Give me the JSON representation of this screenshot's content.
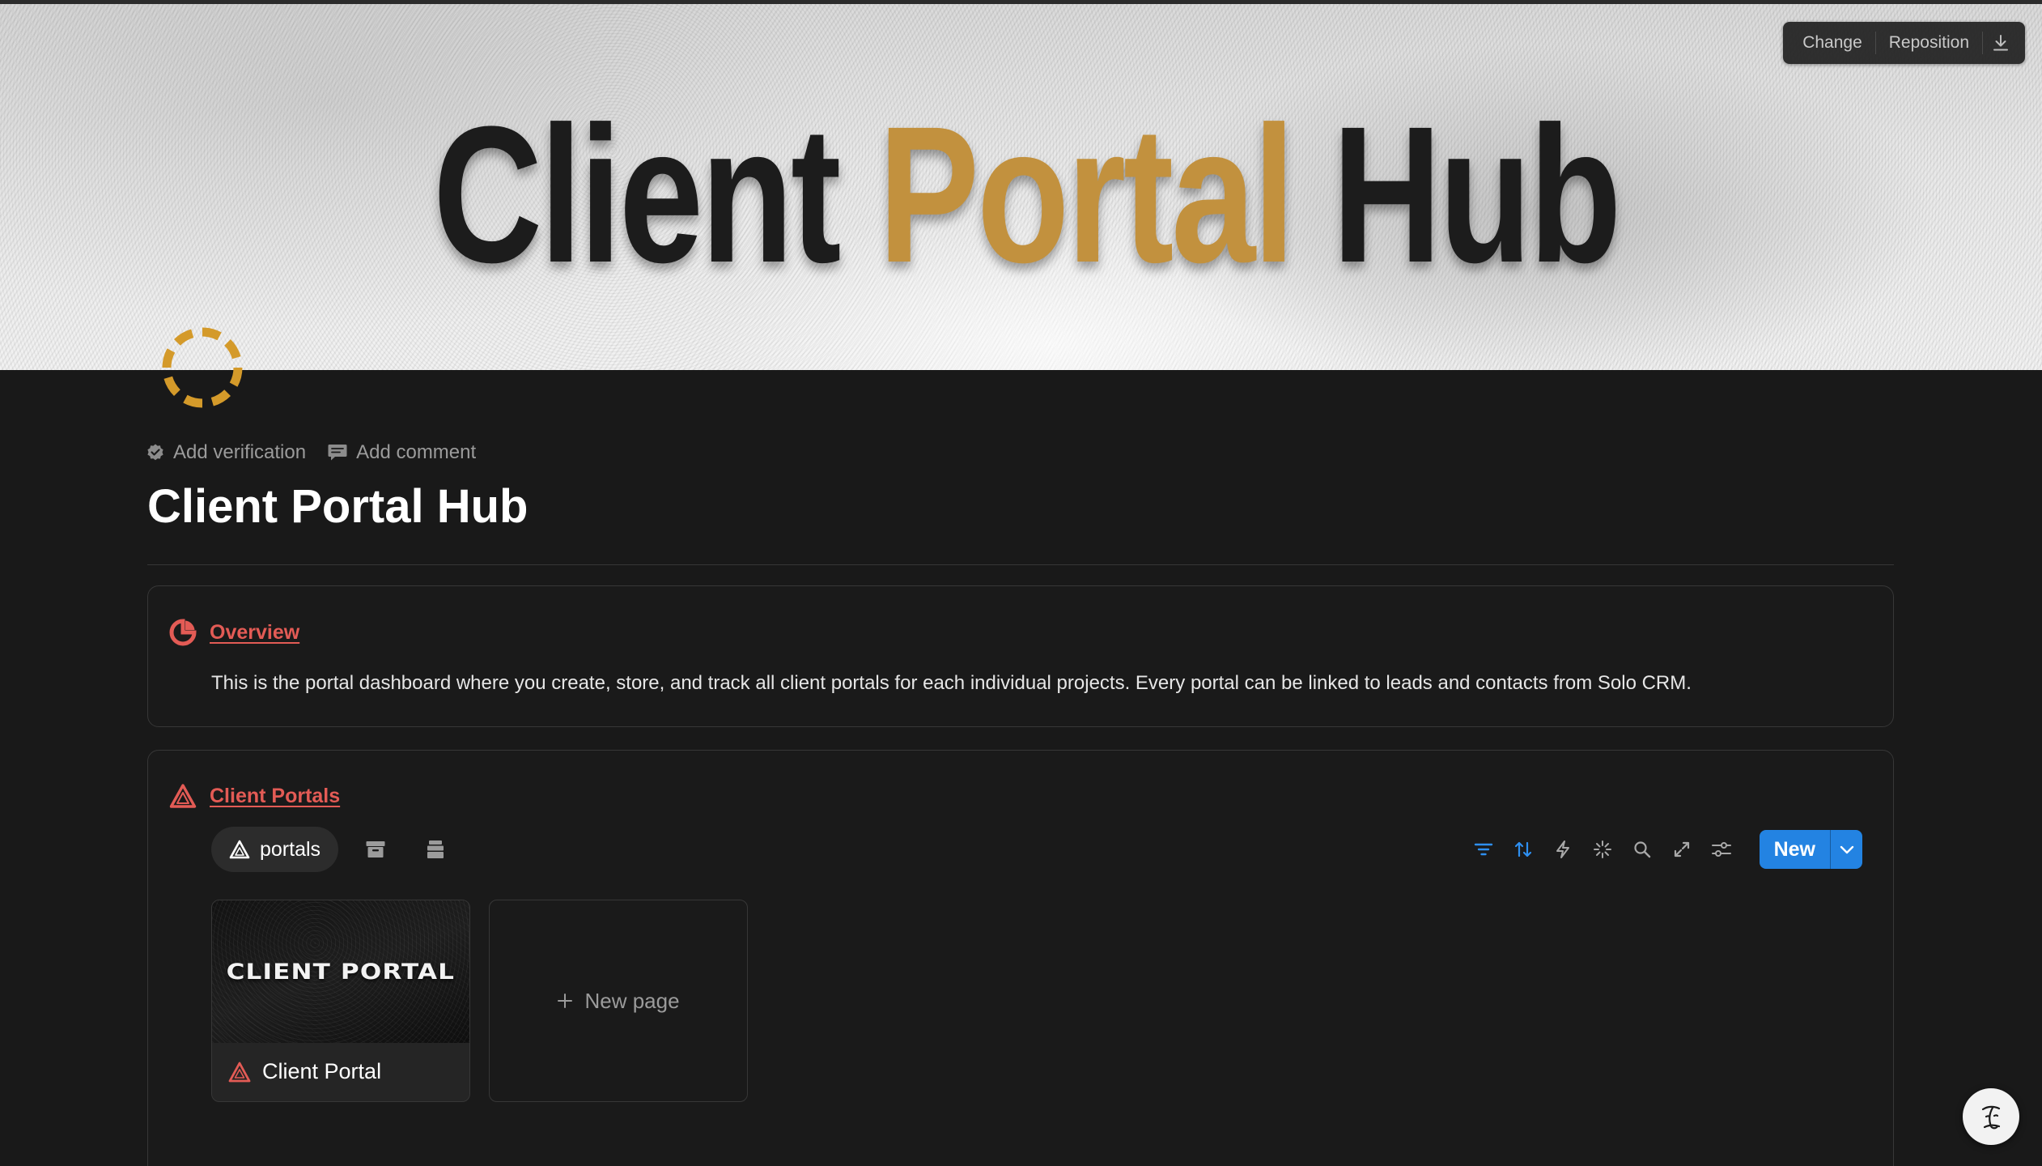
{
  "cover": {
    "title_word1": "Client",
    "title_word2": "Portal",
    "title_word3": "Hub",
    "accent_color": "#c2913e",
    "toolbar": {
      "change_label": "Change",
      "reposition_label": "Reposition",
      "download_icon": "download-icon"
    }
  },
  "page": {
    "icon": "dashed-circle-icon",
    "icon_color": "#d49a2a",
    "add_verification_label": "Add verification",
    "add_comment_label": "Add comment",
    "title": "Client Portal Hub"
  },
  "overview": {
    "heading": "Overview",
    "heading_color": "#e35b55",
    "body": "This is the portal dashboard where you create, store, and track all client portals for each individual projects. Every portal can be linked to leads and contacts from Solo CRM."
  },
  "portals": {
    "heading": "Client Portals",
    "views": [
      {
        "label": "portals",
        "active": true
      }
    ],
    "tools": [
      "filter-icon",
      "sort-icon",
      "automation-icon",
      "ai-sparkle-icon",
      "search-icon",
      "expand-icon",
      "settings-icon"
    ],
    "new_label": "New",
    "gallery": [
      {
        "cover_text": "CLIENT PORTAL",
        "title": "Client Portal"
      }
    ],
    "new_page_label": "New page"
  },
  "help": {
    "icon": "notion-face-icon"
  }
}
